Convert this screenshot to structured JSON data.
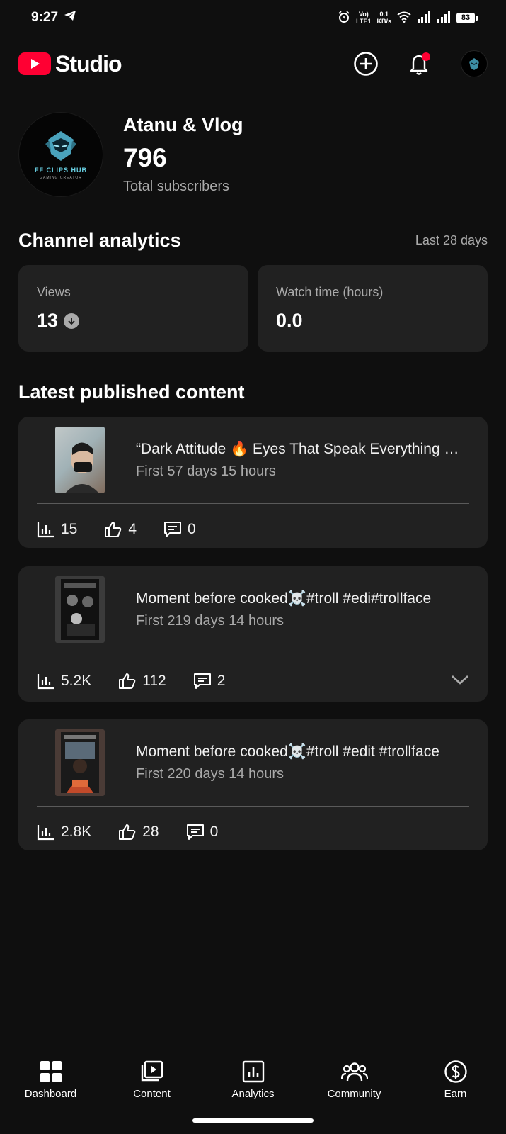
{
  "status_bar": {
    "time": "9:27",
    "net_top": "Vo)",
    "net_bottom": "LTE1",
    "speed_top": "0.1",
    "speed_bottom": "KB/s",
    "battery": "83"
  },
  "app_bar": {
    "title": "Studio",
    "icons": [
      "create-icon",
      "notification-bell-icon",
      "account-avatar"
    ],
    "brand_color": "#ff0033"
  },
  "channel": {
    "name": "Atanu & Vlog",
    "subscribers": "796",
    "subscribers_label": "Total subscribers",
    "avatar_text": "FF CLIPS HUB",
    "avatar_subtext": "GAMING CREATOR"
  },
  "analytics": {
    "title": "Channel analytics",
    "range": "Last 28 days",
    "views_label": "Views",
    "views_value": "13",
    "watch_label": "Watch time (hours)",
    "watch_value": "0.0"
  },
  "latest": {
    "title": "Latest published content",
    "items": [
      {
        "title": "“Dark Attitude 🔥 Eyes That Speak Everything …",
        "subtitle": "First 57 days 15 hours",
        "views": "15",
        "likes": "4",
        "comments": "0"
      },
      {
        "title": "Moment before cooked☠️#troll #edi#trollface",
        "subtitle": "First 219 days 14 hours",
        "views": "5.2K",
        "likes": "112",
        "comments": "2"
      },
      {
        "title": "Moment before cooked☠️#troll #edit #trollface",
        "subtitle": "First 220 days 14 hours",
        "views": "2.8K",
        "likes": "28",
        "comments": "0"
      }
    ]
  },
  "bottom_nav": [
    {
      "label": "Dashboard",
      "icon": "dashboard-icon"
    },
    {
      "label": "Content",
      "icon": "content-icon"
    },
    {
      "label": "Analytics",
      "icon": "analytics-icon"
    },
    {
      "label": "Community",
      "icon": "community-icon"
    },
    {
      "label": "Earn",
      "icon": "earn-icon"
    }
  ]
}
